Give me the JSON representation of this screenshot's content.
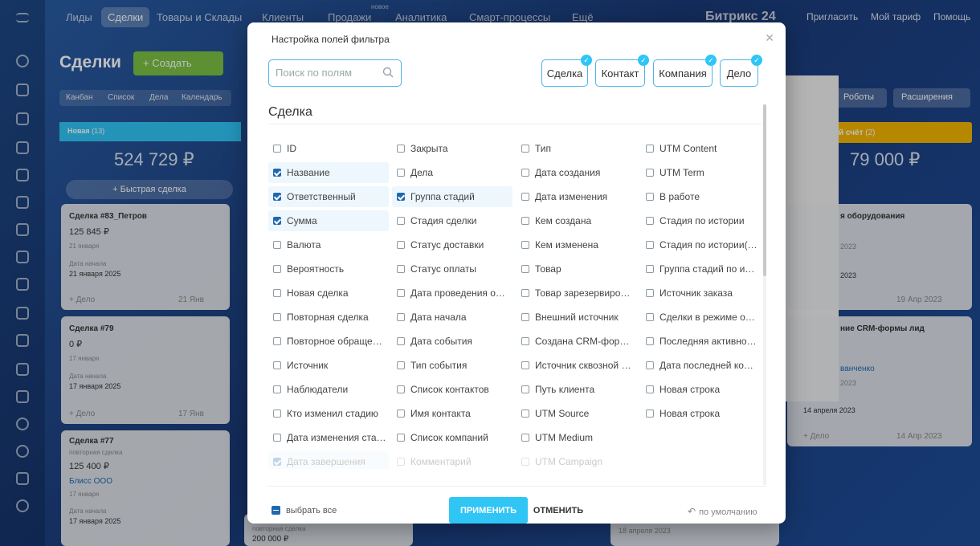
{
  "topbar": {
    "nav": [
      "Лиды",
      "Сделки",
      "Товары и Склады",
      "Клиенты",
      "Продажи",
      "Аналитика",
      "Смарт-процессы",
      "Ещё"
    ],
    "new_badge": "новое",
    "brand": "Битрикс 24",
    "invite": "Пригласить",
    "tariff": "Мой тариф",
    "help": "Помощь"
  },
  "page": {
    "title": "Сделки",
    "create": "+ Создать",
    "views": [
      "Канбан",
      "Список",
      "Дела",
      "Календарь"
    ],
    "robots": "Роботы",
    "extensions": "Расширения"
  },
  "kanban": {
    "col1": {
      "label": "Новая",
      "count": "(13)",
      "sum": "524 729 ₽",
      "quick": "+ Быстрая сделка"
    },
    "col_right": {
      "label": "й счёт",
      "count": "(2)",
      "sum": "79 000 ₽"
    },
    "cards": [
      {
        "title": "Сделка #83_Петров",
        "amount": "125 845 ₽",
        "date": "21 января",
        "start_label": "Дата начала",
        "start": "21 января 2025",
        "action": "+ Дело",
        "stamp": "21 Янв"
      },
      {
        "title": "Сделка #79",
        "amount": "0 ₽",
        "date": "17 января",
        "start_label": "Дата начала",
        "start": "17 января 2025",
        "action": "+ Дело",
        "stamp": "17 Янв"
      },
      {
        "title": "Сделка #77",
        "sub": "повторная сделка",
        "amount": "125 400 ₽",
        "company": "Блисс ООО",
        "date": "17 января",
        "start_label": "Дата начала",
        "start": "17 января 2025"
      }
    ],
    "right_cards": [
      {
        "title": "я оборудования",
        "d1": "2023",
        "d2": "2023",
        "stamp": "19 Апр 2023"
      },
      {
        "title": "ние CRM-формы лид",
        "person": "ванченко",
        "d1": "2023",
        "d2": "14 апреля 2023",
        "action": "+ Дело",
        "stamp": "14 Апр 2023"
      }
    ],
    "bottom": {
      "sub": "повторная сделка",
      "amount": "200 000 ₽",
      "date": "18 апреля 2023"
    }
  },
  "modal": {
    "title": "Настройка полей фильтра",
    "search_placeholder": "Поиск по полям",
    "chips": [
      "Сделка",
      "Контакт",
      "Компания",
      "Дело"
    ],
    "section": "Сделка",
    "fields": [
      [
        "ID",
        "Название",
        "Ответственный",
        "Сумма",
        "Валюта",
        "Вероятность",
        "Новая сделка",
        "Повторная сделка",
        "Повторное обращение",
        "Источник",
        "Наблюдатели",
        "Кто изменил стадию",
        "Дата изменения стадии",
        "Дата завершения"
      ],
      [
        "Закрыта",
        "Дела",
        "Группа стадий",
        "Стадия сделки",
        "Статус доставки",
        "Статус оплаты",
        "Дата проведения оплаты",
        "Дата начала",
        "Дата события",
        "Тип события",
        "Список контактов",
        "Имя контакта",
        "Список компаний",
        "Комментарий"
      ],
      [
        "Тип",
        "Дата создания",
        "Дата изменения",
        "Кем создана",
        "Кем изменена",
        "Товар",
        "Товар зарезервирован",
        "Внешний источник",
        "Создана CRM-формой",
        "Источник сквозной аналитики",
        "Путь клиента",
        "UTM Source",
        "UTM Medium",
        "UTM Campaign"
      ],
      [
        "UTM Content",
        "UTM Term",
        "В работе",
        "Стадия по истории",
        "Стадия по истории(семантика)",
        "Группа стадий по истории",
        "Источник заказа",
        "Сделки в режиме ожидания",
        "Последняя активность",
        "Дата последней коммуникации",
        "Новая строка",
        "Новая строка"
      ]
    ],
    "select_all": "выбрать все",
    "apply": "ПРИМЕНИТЬ",
    "cancel": "ОТМЕНИТЬ",
    "reset": "по умолчанию"
  }
}
